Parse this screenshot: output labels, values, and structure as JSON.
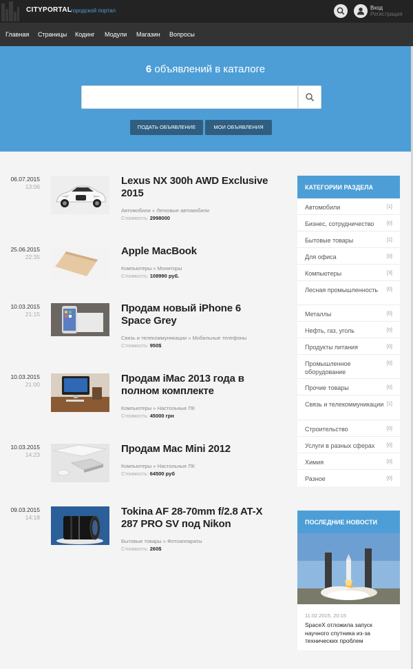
{
  "header": {
    "logo_name": "CITYPORTAL",
    "logo_tagline": "городской портал",
    "login": "Вход",
    "register": "Регистрация"
  },
  "nav": [
    "Главная",
    "Страницы",
    "Кодинг",
    "Модули",
    "Магазин",
    "Вопросы"
  ],
  "hero": {
    "count": "6",
    "title_rest": "объявлений в каталоге",
    "search_placeholder": "",
    "add_button": "ПОДАТЬ ОБЪЯВЛЕНИЕ",
    "my_button": "МОИ ОБЪЯВЛЕНИЯ"
  },
  "listings": [
    {
      "date": "06.07.2015",
      "time": "13:06",
      "title": "Lexus NX 300h AWD Exclusive 2015",
      "category": "Автомобили",
      "subcategory": "Легковые автомобили",
      "cost_label": "Стоимость:",
      "price": "2998000",
      "image": "car"
    },
    {
      "date": "25.06.2015",
      "time": "22:35",
      "title": "Apple MacBook",
      "category": "Компьютеры",
      "subcategory": "Мониторы",
      "cost_label": "Стоимость:",
      "price": "108990 руб.",
      "image": "laptop"
    },
    {
      "date": "10.03.2015",
      "time": "21:15",
      "title": "Продам новый iPhone 6 Space Grey",
      "category": "Связь и телекоммуникации",
      "subcategory": "Мобильные телефоны",
      "cost_label": "Стоимость:",
      "price": "950$",
      "image": "phone"
    },
    {
      "date": "10.03.2015",
      "time": "21:00",
      "title": "Продам iMac 2013 года в полном комплекте",
      "category": "Компьютеры",
      "subcategory": "Настольные ПК",
      "cost_label": "Стоимость:",
      "price": "45000 грн",
      "image": "imac"
    },
    {
      "date": "10.03.2015",
      "time": "14:23",
      "title": "Продам Mac Mini 2012",
      "category": "Компьютеры",
      "subcategory": "Настольные ПК",
      "cost_label": "Стоимость:",
      "price": "64500 руб",
      "image": "macmini"
    },
    {
      "date": "09.03.2015",
      "time": "14:18",
      "title": "Tokina AF 28-70mm f/2.8 AT-X 287 PRO SV под Nikon",
      "category": "Бытовые товары",
      "subcategory": "Фотоаппараты",
      "cost_label": "Стоимость:",
      "price": "260$",
      "image": "lens"
    }
  ],
  "sidebar": {
    "categories_title": "КАТЕГОРИИ РАЗДЕЛА",
    "categories": [
      {
        "name": "Автомобили",
        "count": "[1]"
      },
      {
        "name": "Бизнес, сотрудничество",
        "count": "[0]"
      },
      {
        "name": "Бытовые товары",
        "count": "[1]"
      },
      {
        "name": "Для офиса",
        "count": "[0]"
      },
      {
        "name": "Компьютеры",
        "count": "[3]"
      },
      {
        "name": "Лесная промышленность",
        "count": "[0]"
      },
      {
        "name": "Металлы",
        "count": "[0]"
      },
      {
        "name": "Нефть, газ, уголь",
        "count": "[0]"
      },
      {
        "name": "Продукты питания",
        "count": "[0]"
      },
      {
        "name": "Промышленное оборудование",
        "count": "[0]"
      },
      {
        "name": "Прочие товары",
        "count": "[0]"
      },
      {
        "name": "Связь и телекоммуникации",
        "count": "[1]"
      },
      {
        "name": "Строительство",
        "count": "[0]"
      },
      {
        "name": "Услуги в разных сферах",
        "count": "[0]"
      },
      {
        "name": "Химия",
        "count": "[0]"
      },
      {
        "name": "Разное",
        "count": "[0]"
      }
    ],
    "news_title": "ПОСЛЕДНИЕ НОВОСТИ",
    "news_date": "11.02.2015, 20:15",
    "news_text": "SpaceX отложила запуск научного спутника из-за технических проблем"
  },
  "colors": {
    "accent": "#4d9ed6",
    "topbar": "#232323",
    "navbar": "#333333",
    "button_dark": "#2f5e80"
  }
}
